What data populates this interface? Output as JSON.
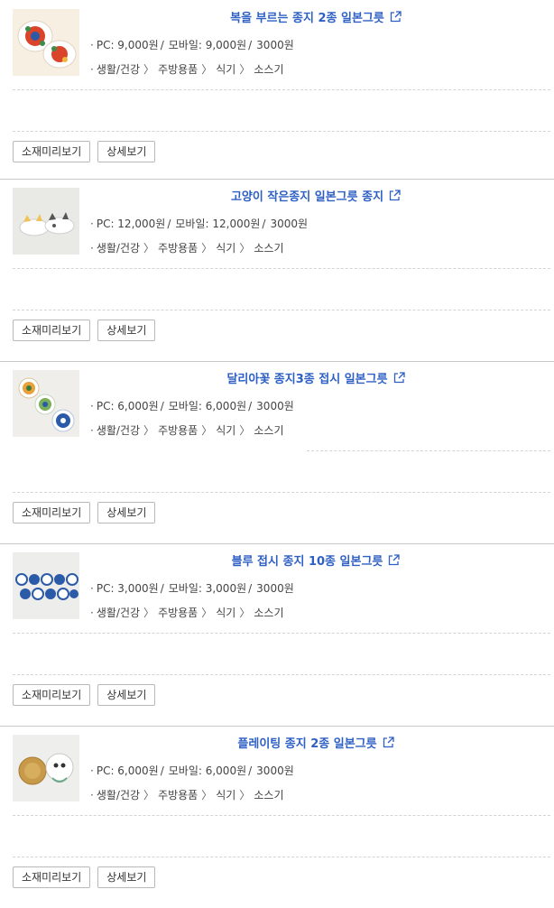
{
  "common": {
    "preview_button_label": "소재미리보기",
    "detail_button_label": "상세보기",
    "link_color": "#2d5fc4"
  },
  "products": [
    {
      "title": "복을 부르는 종지 2종 일본그릇",
      "price_pc": "PC: 9,000원",
      "price_mobile": "모바일: 9,000원",
      "shipping": "3000원",
      "category": [
        "생활/건강",
        "주방용품",
        "식기",
        "소스기"
      ],
      "thumbnail_icon": "floral-plates-thumbnail"
    },
    {
      "title": "고양이 작은종지 일본그릇 종지",
      "price_pc": "PC: 12,000원",
      "price_mobile": "모바일: 12,000원",
      "shipping": "3000원",
      "category": [
        "생활/건강",
        "주방용품",
        "식기",
        "소스기"
      ],
      "thumbnail_icon": "cat-dishes-thumbnail"
    },
    {
      "title": "달리아꽃 종지3종 접시 일본그릇",
      "price_pc": "PC: 6,000원",
      "price_mobile": "모바일: 6,000원",
      "shipping": "3000원",
      "category": [
        "생활/건강",
        "주방용품",
        "식기",
        "소스기"
      ],
      "thumbnail_icon": "dahlia-dishes-thumbnail"
    },
    {
      "title": "블루 접시 종지 10종 일본그릇",
      "price_pc": "PC: 3,000원",
      "price_mobile": "모바일: 3,000원",
      "shipping": "3000원",
      "category": [
        "생활/건강",
        "주방용품",
        "식기",
        "소스기"
      ],
      "thumbnail_icon": "blue-dishes-thumbnail"
    },
    {
      "title": "플레이팅 종지 2종 일본그릇",
      "price_pc": "PC: 6,000원",
      "price_mobile": "모바일: 6,000원",
      "shipping": "3000원",
      "category": [
        "생활/건강",
        "주방용품",
        "식기",
        "소스기"
      ],
      "thumbnail_icon": "plating-dishes-thumbnail"
    }
  ]
}
